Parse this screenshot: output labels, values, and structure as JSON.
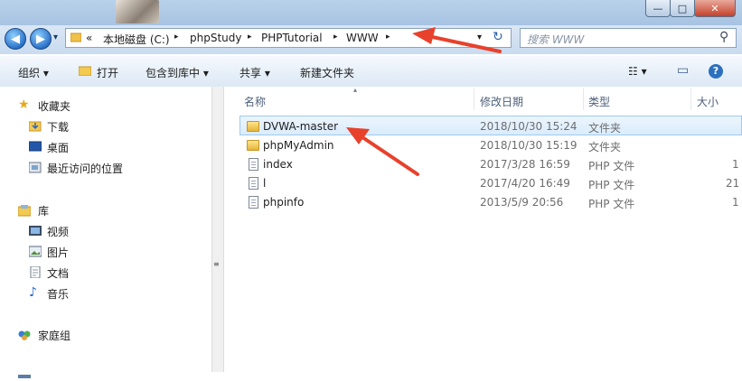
{
  "window": {
    "minimize_glyph": "—",
    "maximize_glyph": "□",
    "close_glyph": "✕"
  },
  "address": {
    "back_glyph": "◀",
    "forward_glyph": "▶",
    "history_glyph": "▾",
    "overflow": "«",
    "crumbs": [
      "本地磁盘 (C:)",
      "phpStudy",
      "PHPTutorial",
      "WWW"
    ],
    "dropdown_glyph": "▾",
    "refresh_glyph": "↻"
  },
  "search": {
    "placeholder": "搜索 WWW",
    "icon_glyph": "⚲"
  },
  "toolbar": {
    "organize": "组织 ▾",
    "open": "打开",
    "include_in_library": "包含到库中 ▾",
    "share": "共享 ▾",
    "new_folder": "新建文件夹",
    "view_glyph": "☷ ▾",
    "preview_glyph": "▭",
    "help_glyph": "?"
  },
  "nav": {
    "favorites": "收藏夹",
    "downloads": "下载",
    "desktop": "桌面",
    "recent": "最近访问的位置",
    "libraries": "库",
    "videos": "视频",
    "pictures": "图片",
    "documents": "文档",
    "music": "音乐",
    "homegroup": "家庭组",
    "splitter_glyph": "≡"
  },
  "columns": {
    "name": "名称",
    "modified": "修改日期",
    "type": "类型",
    "size": "大小",
    "sort_glyph": "▴"
  },
  "files": [
    {
      "name": "DVWA-master",
      "date": "2018/10/30 15:24",
      "type": "文件夹",
      "size": "",
      "kind": "folder"
    },
    {
      "name": "phpMyAdmin",
      "date": "2018/10/30 15:19",
      "type": "文件夹",
      "size": "",
      "kind": "folder"
    },
    {
      "name": "index",
      "date": "2017/3/28 16:59",
      "type": "PHP 文件",
      "size": "1",
      "kind": "file"
    },
    {
      "name": "l",
      "date": "2017/4/20 16:49",
      "type": "PHP 文件",
      "size": "21",
      "kind": "file"
    },
    {
      "name": "phpinfo",
      "date": "2013/5/9 20:56",
      "type": "PHP 文件",
      "size": "1",
      "kind": "file"
    }
  ],
  "colors": {
    "annotation_arrow": "#e8412c",
    "selection": "#dbecfc"
  }
}
